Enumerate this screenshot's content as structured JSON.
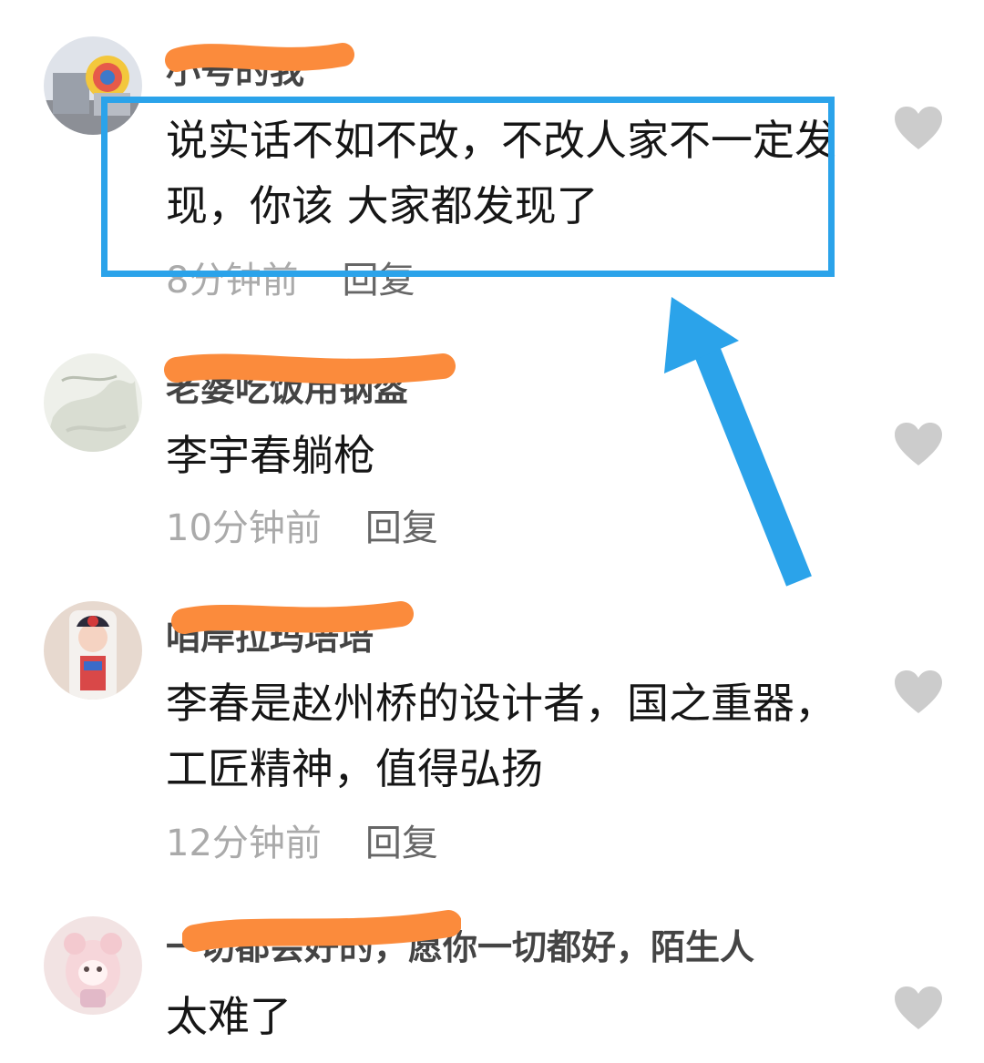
{
  "comments": [
    {
      "username_visible": "小号的我",
      "text": "说实话不如不改，不改人家不一定发现，你该 大家都发现了",
      "time": "8分钟前",
      "reply_label": "回复"
    },
    {
      "username_visible": "老婆吃饭用钢盔",
      "text": "李宇春躺枪",
      "time": "10分钟前",
      "reply_label": "回复"
    },
    {
      "username_visible": "咱岸拉玛培培",
      "text": "李春是赵州桥的设计者，国之重器，工匠精神，值得弘扬",
      "time": "12分钟前",
      "reply_label": "回复"
    },
    {
      "username_prefix": "一切都会好的",
      "username_suffix": "，愿你一切都好，陌生人",
      "text": "太难了"
    }
  ],
  "colors": {
    "highlight": "#2ba3ea",
    "redaction": "#fb8b3c",
    "like_icon": "#cccccc"
  }
}
